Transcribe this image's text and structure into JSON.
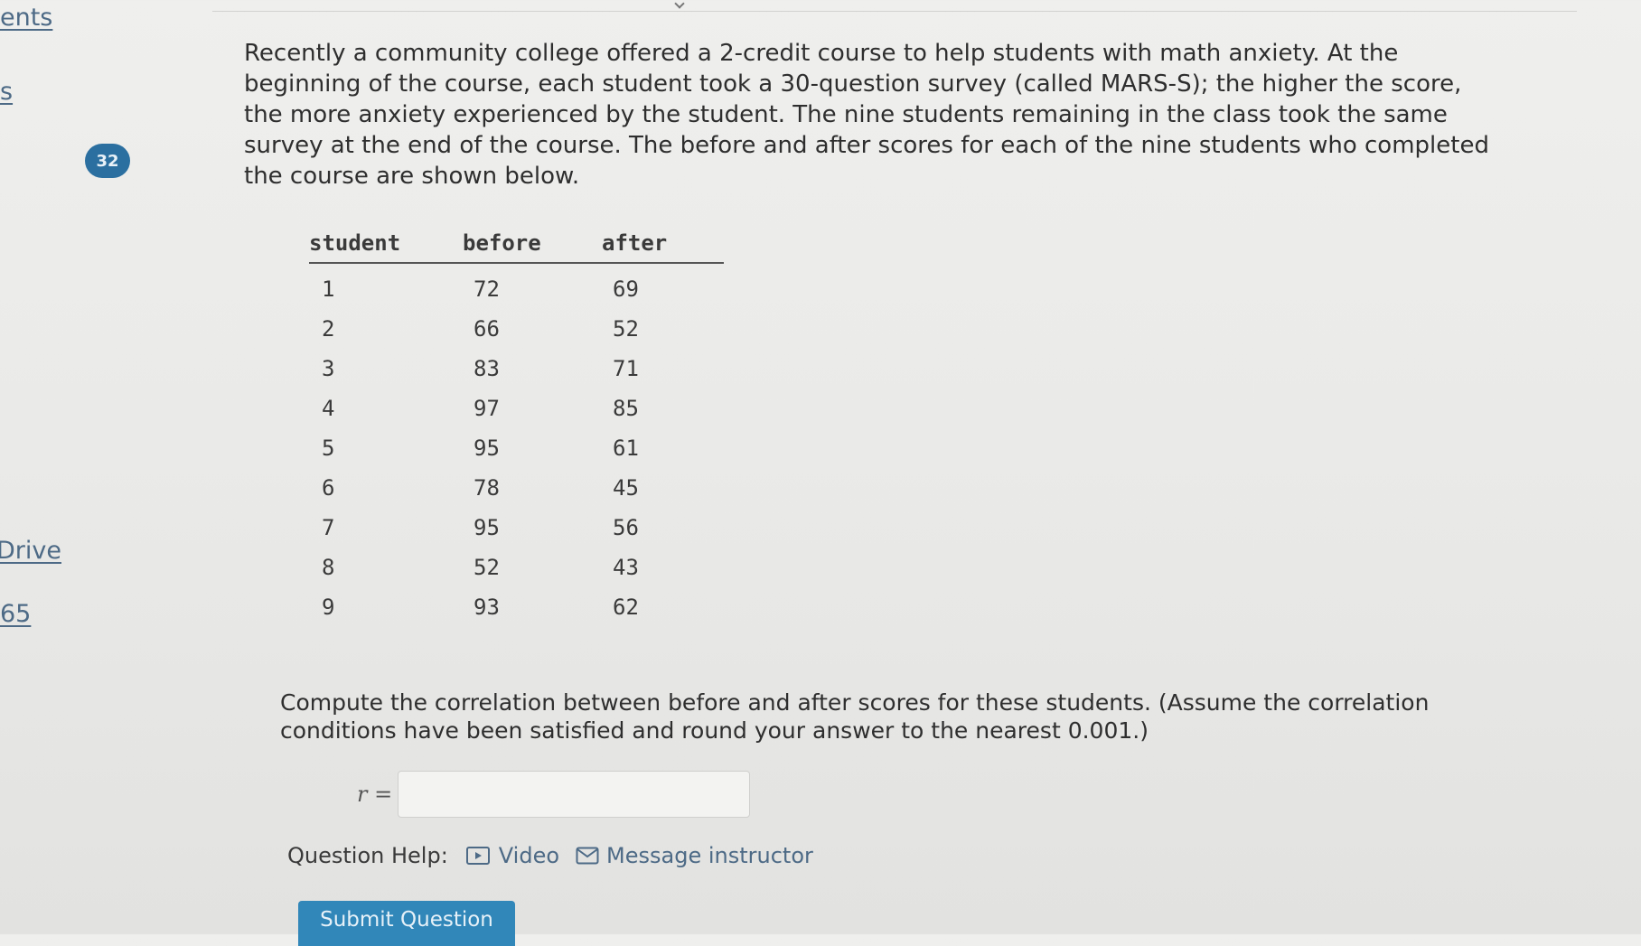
{
  "sidebar": {
    "link_assignments": "ents",
    "link_grades": "s",
    "question_number": "32",
    "link_drive": "Drive",
    "link_points": "65"
  },
  "problem": {
    "text": "Recently a community college offered a 2-credit course to help students with math anxiety. At the beginning of the course, each student took a 30-question survey (called MARS-S); the higher the score, the more anxiety experienced by the student. The nine students remaining in the class took the same survey at the end of the course. The before and after scores for each of the nine students who completed the course are shown below."
  },
  "table": {
    "headers": [
      "student",
      "before",
      "after"
    ],
    "rows": [
      [
        "1",
        "72",
        "69"
      ],
      [
        "2",
        "66",
        "52"
      ],
      [
        "3",
        "83",
        "71"
      ],
      [
        "4",
        "97",
        "85"
      ],
      [
        "5",
        "95",
        "61"
      ],
      [
        "6",
        "78",
        "45"
      ],
      [
        "7",
        "95",
        "56"
      ],
      [
        "8",
        "52",
        "43"
      ],
      [
        "9",
        "93",
        "62"
      ]
    ]
  },
  "question": {
    "text": "Compute the correlation between before and after scores for these students. (Assume the correlation conditions have been satisfied and round your answer to the nearest 0.001.)",
    "answer_label": "r =",
    "answer_value": ""
  },
  "help": {
    "label": "Question Help:",
    "video_label": "Video",
    "message_label": "Message instructor"
  },
  "submit": {
    "label": "Submit Question"
  },
  "colors": {
    "link": "#4d6a86",
    "badge": "#2b6fa0",
    "submit": "#3187b9"
  },
  "icons": {
    "video": "video-icon",
    "message": "mail-icon"
  }
}
